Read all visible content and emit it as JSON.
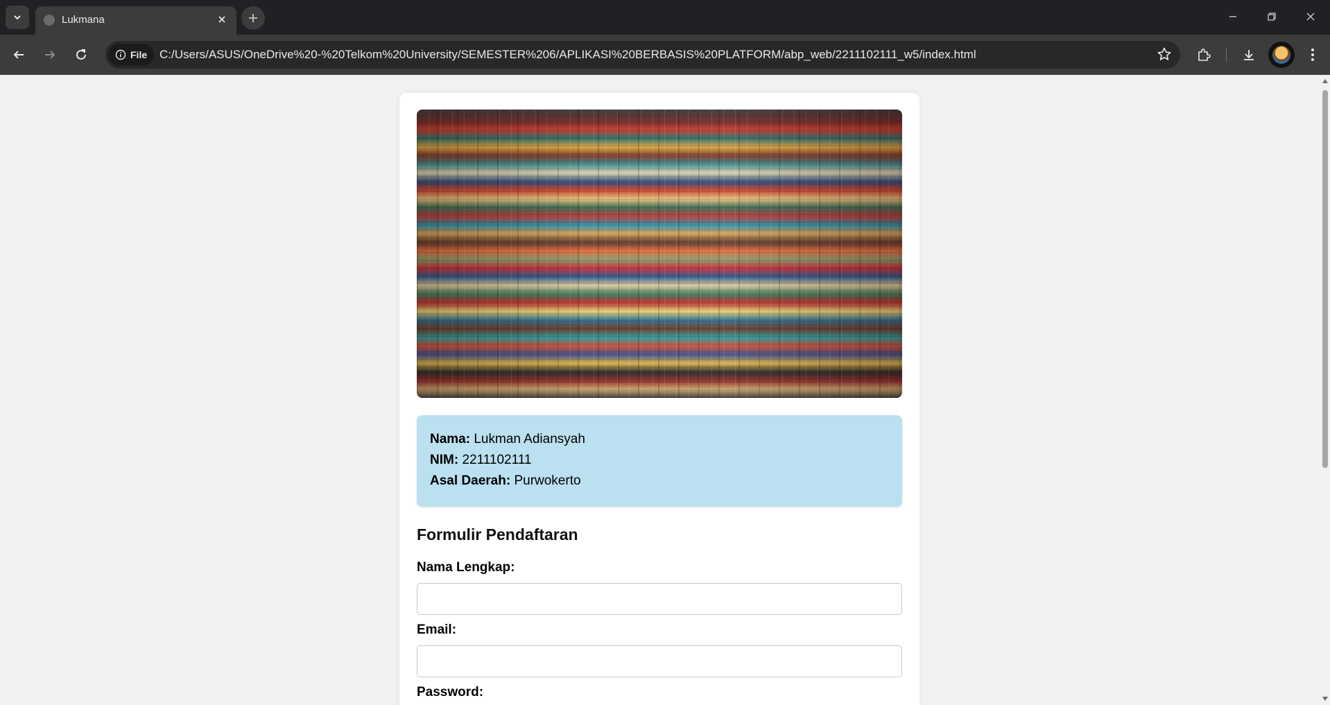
{
  "browser": {
    "tab_title": "Lukmana",
    "file_chip": "File",
    "url": "C:/Users/ASUS/OneDrive%20-%20Telkom%20University/SEMESTER%206/APLIKASI%20BERBASIS%20PLATFORM/abp_web/2211102111_w5/index.html"
  },
  "profile": {
    "nama_label": "Nama:",
    "nama_value": "Lukman Adiansyah",
    "nim_label": "NIM:",
    "nim_value": "2211102111",
    "asal_label": "Asal Daerah:",
    "asal_value": "Purwokerto"
  },
  "form": {
    "title": "Formulir Pendaftaran",
    "nama_lengkap_label": "Nama Lengkap:",
    "nama_lengkap_value": "",
    "email_label": "Email:",
    "email_value": "",
    "password_label": "Password:"
  },
  "colors": {
    "info_box": "#bbe0ef",
    "chrome_dark": "#202124",
    "toolbar": "#3c3c3c",
    "page_bg": "#f2f2f2"
  }
}
